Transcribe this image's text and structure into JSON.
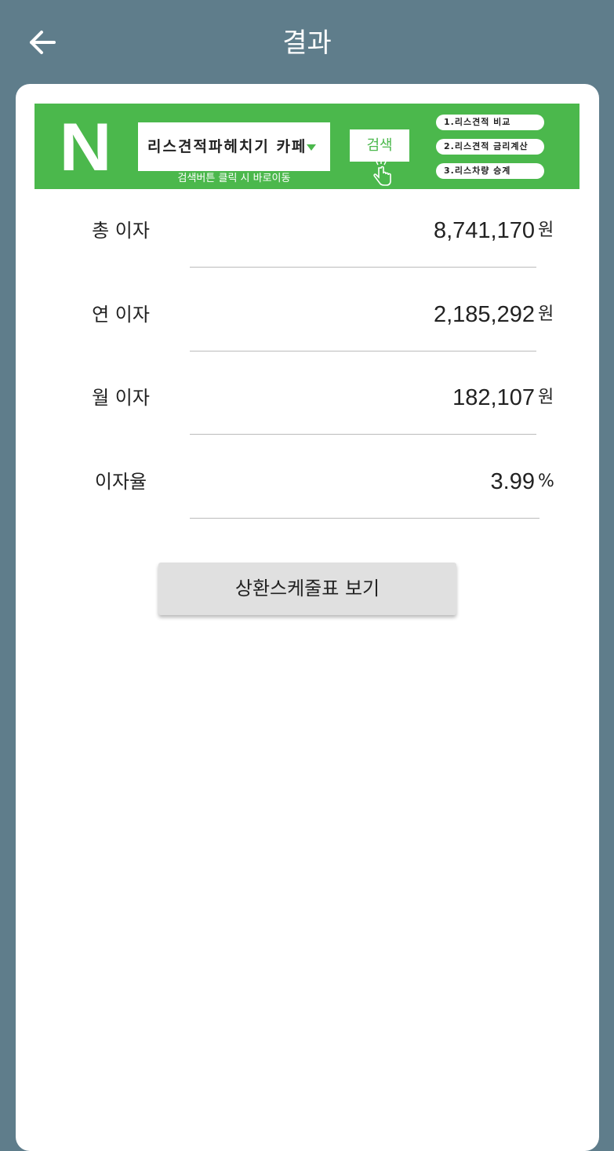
{
  "header": {
    "title": "결과",
    "back_icon": "arrow-left-icon"
  },
  "banner": {
    "logo_text": "N",
    "search_text": "리스견적파헤치기 카페",
    "search_button": "검색",
    "hint": "검색버튼 클릭 시 바로이동",
    "links": [
      "1.리스견적 비교",
      "2.리스견적 금리계산",
      "3.리스차량 승계"
    ],
    "colors": {
      "background": "#4bb84c",
      "text": "#ffffff"
    }
  },
  "results": [
    {
      "label": "총 이자",
      "value": "8,741,170",
      "unit": "원"
    },
    {
      "label": "연 이자",
      "value": "2,185,292",
      "unit": "원"
    },
    {
      "label": "월 이자",
      "value": "182,107",
      "unit": "원"
    },
    {
      "label": "이자율",
      "value": "3.99",
      "unit": "%"
    }
  ],
  "schedule_button": "상환스케줄표 보기",
  "colors": {
    "app_background": "#5f7d8b",
    "card": "#ffffff",
    "button": "#e0e0e0"
  }
}
